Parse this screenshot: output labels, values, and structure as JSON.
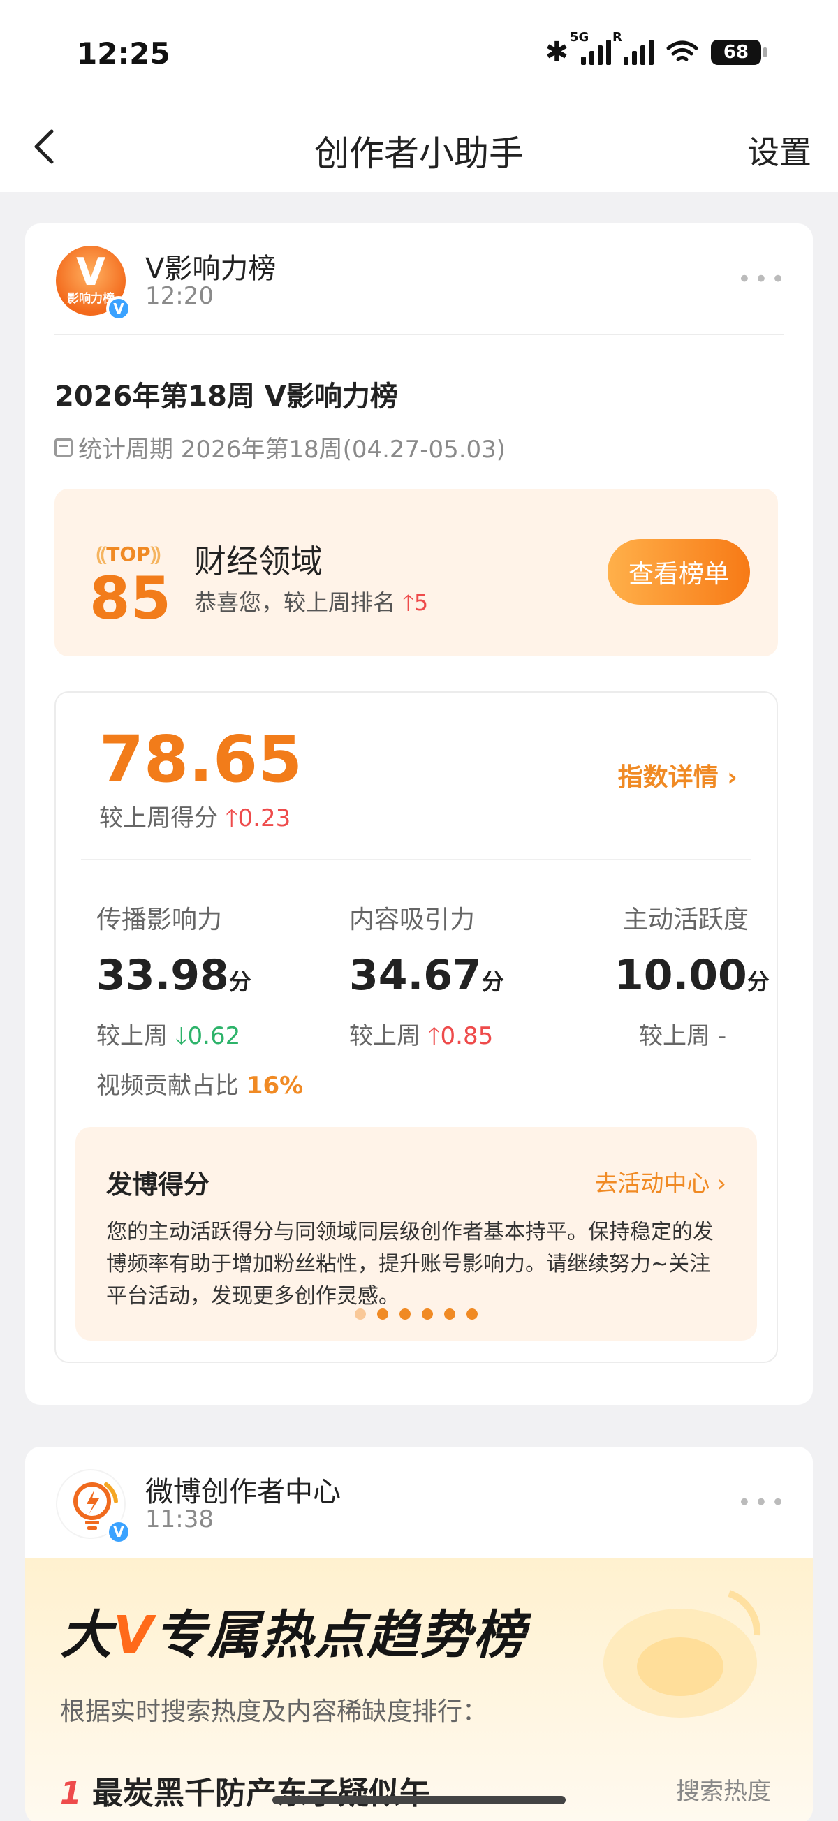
{
  "status_bar": {
    "time": "12:25",
    "network_tag_1": "5G",
    "network_tag_2": "R",
    "battery": "68"
  },
  "nav": {
    "title": "创作者小助手",
    "right_label": "设置",
    "back_icon": "chevron-left-icon"
  },
  "card1": {
    "avatar_letter": "V",
    "avatar_caption": "影响力榜",
    "account_name": "V影响力榜",
    "time": "12:20",
    "post_title": "2026年第18周 V影响力榜",
    "period": "统计周期 2026年第18周(04.27-05.03)",
    "rank": {
      "top_label": "TOP",
      "number": "85",
      "field": "财经领域",
      "sub_text": "恭喜您，较上周排名",
      "change_arrow": "🡑",
      "change_value": "5",
      "button": "查看榜单"
    },
    "score": {
      "value": "78.65",
      "compare_label": "较上周得分",
      "change_arrow": "🡑",
      "change_value": "0.23",
      "details_link": "指数详情 ›"
    },
    "metrics": [
      {
        "label": "传播影响力",
        "value": "33.98",
        "unit": "分",
        "compare_label": "较上周",
        "change_arrow": "🡓",
        "change_value": "0.62",
        "extra_label": "视频贡献占比",
        "extra_value": "16%"
      },
      {
        "label": "内容吸引力",
        "value": "34.67",
        "unit": "分",
        "compare_label": "较上周",
        "change_arrow": "🡑",
        "change_value": "0.85"
      },
      {
        "label": "主动活跃度",
        "value": "10.00",
        "unit": "分",
        "compare_label": "较上周",
        "change_value": "-"
      }
    ],
    "tip": {
      "title": "发博得分",
      "link": "去活动中心 ›",
      "body": "您的主动活跃得分与同领域同层级创作者基本持平。保持稳定的发博频率有助于增加粉丝粘性，提升账号影响力。请继续努力~关注平台活动，发现更多创作灵感。",
      "page_count": 6,
      "active_page": 1
    }
  },
  "card2": {
    "account_name": "微博创作者中心",
    "time": "11:38",
    "banner": {
      "title_pre": "大",
      "title_v": "V",
      "title_post": "专属热点趋势榜",
      "subtitle": "根据实时搜索热度及内容稀缺度排行：",
      "first_item_index": "1",
      "first_item_text": "最炭黑千防产东子疑似午",
      "first_item_metric": "搜索热度"
    }
  },
  "colors": {
    "accent": "#f27c1a",
    "rise": "#ee4b4b",
    "fall": "#2db36a"
  }
}
